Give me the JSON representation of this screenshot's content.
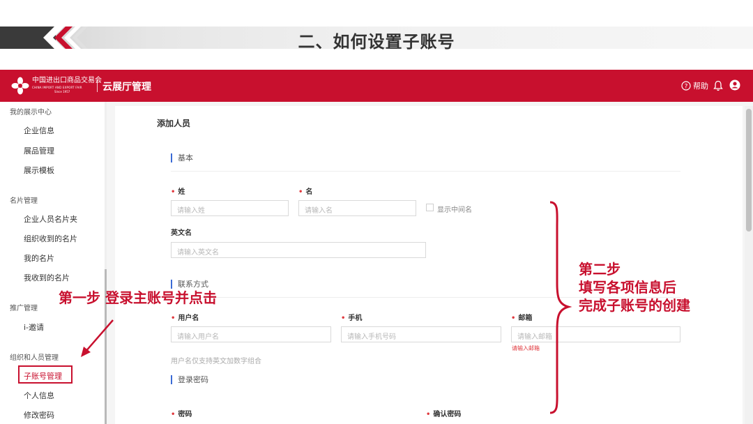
{
  "slide": {
    "title": "二、如何设置子账号"
  },
  "header": {
    "logo_cn": "中国进出口商品交易会",
    "logo_en": "CHINA IMPORT AND EXPORT FAIR",
    "logo_since": "Since 1957",
    "app_name": "云展厅管理",
    "help_label": "帮助",
    "brand_color": "#c8102e"
  },
  "sidebar": {
    "groups": [
      {
        "title": "我的展示中心",
        "items": [
          "企业信息",
          "展品管理",
          "展示模板"
        ]
      },
      {
        "title": "名片管理",
        "items": [
          "企业人员名片夹",
          "组织收到的名片",
          "我的名片",
          "我收到的名片"
        ]
      },
      {
        "title": "推广管理",
        "items": [
          "i-邀请"
        ]
      },
      {
        "title": "组织和人员管理",
        "items": [
          "子账号管理",
          "个人信息",
          "修改密码"
        ]
      }
    ],
    "active_item": "子账号管理"
  },
  "form": {
    "page_title": "添加人员",
    "section_basic": "基本",
    "last_name_label": "姓",
    "last_name_placeholder": "请输入姓",
    "first_name_label": "名",
    "first_name_placeholder": "请输入名",
    "show_middle_name": "显示中间名",
    "english_name_label": "英文名",
    "english_name_placeholder": "请输入英文名",
    "section_contact": "联系方式",
    "username_label": "用户名",
    "username_placeholder": "请输入用户名",
    "phone_label": "手机",
    "phone_placeholder": "请输入手机号码",
    "email_label": "邮箱",
    "email_placeholder": "请输入邮箱",
    "email_error": "请输入邮箱",
    "username_hint": "用户名仅支持英文加数字组合",
    "section_password": "登录密码",
    "password_label": "密码",
    "confirm_password_label": "确认密码"
  },
  "annotations": {
    "step1": "第一步   登录主账号并点击",
    "step2_line1": "第二步",
    "step2_line2": "填写各项信息后",
    "step2_line3": "完成子账号的创建",
    "color": "#c8102e"
  }
}
